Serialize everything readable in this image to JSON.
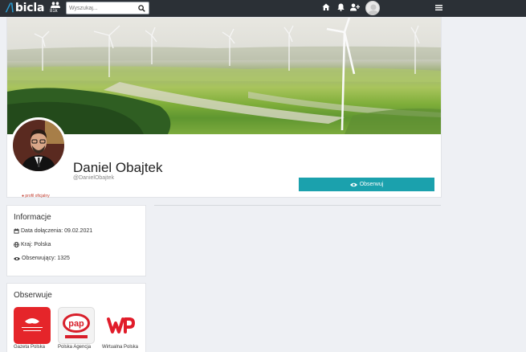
{
  "topbar": {
    "logo_text": "bicla",
    "users_count": "81k",
    "search_placeholder": "Wyszukaj..."
  },
  "profile": {
    "name": "Daniel Obajtek",
    "handle": "@DanielObajtek",
    "official_label": "● profil oficjalny",
    "follow_button": "Obserwuj"
  },
  "info": {
    "title": "Informacje",
    "joined": "Data dołączenia: 09.02.2021",
    "country": "Kraj: Polska",
    "followers": "Obserwujący: 1325"
  },
  "follows": {
    "title": "Obserwuje",
    "items": [
      {
        "name": "Gazeta Polska",
        "logo_text": "GAZETA POLSKA",
        "color": "#e5252a"
      },
      {
        "name": "Polska Agencja",
        "logo_text": "pap",
        "color": "#d81e2a"
      },
      {
        "name": "Wirtualna Polska",
        "logo_text": "WP",
        "color": "#e11c2a"
      }
    ]
  },
  "colors": {
    "accent": "#1ba1ad",
    "topbar": "#2b3036"
  }
}
